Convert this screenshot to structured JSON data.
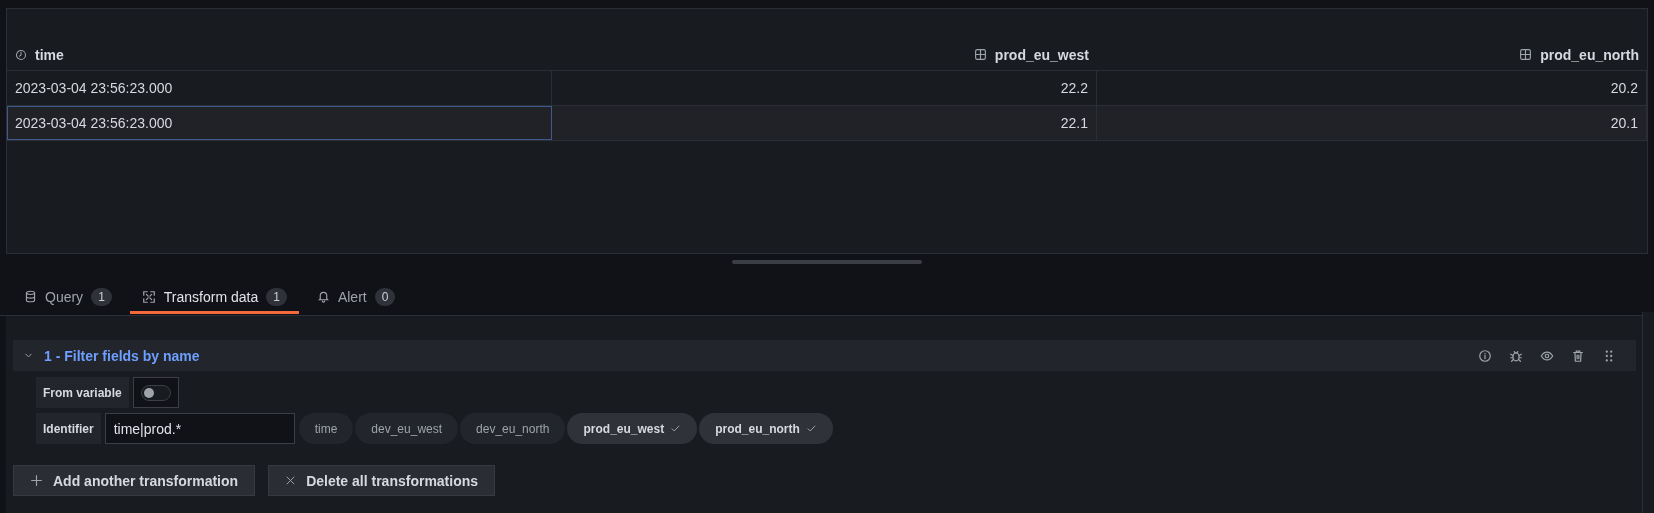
{
  "table": {
    "columns": [
      {
        "label": "time",
        "kind": "time"
      },
      {
        "label": "prod_eu_west",
        "kind": "number"
      },
      {
        "label": "prod_eu_north",
        "kind": "number"
      }
    ],
    "rows": [
      {
        "selected": false,
        "cells": [
          "2023-03-04 23:56:23.000",
          "22.2",
          "20.2"
        ]
      },
      {
        "selected": true,
        "cells": [
          "2023-03-04 23:56:23.000",
          "22.1",
          "20.1"
        ]
      }
    ]
  },
  "tabs": [
    {
      "label": "Query",
      "count": "1",
      "kind": "query",
      "selected": false
    },
    {
      "label": "Transform data",
      "count": "1",
      "kind": "transform",
      "selected": true
    },
    {
      "label": "Alert",
      "count": "0",
      "kind": "alert",
      "selected": false
    }
  ],
  "transformation": {
    "title": "1 - Filter fields by name",
    "expanded": true,
    "from_variable": {
      "label": "From variable",
      "on": false
    },
    "identifier": {
      "label": "Identifier",
      "value": "time|prod.*"
    },
    "fields": [
      {
        "label": "time",
        "selected": false
      },
      {
        "label": "dev_eu_west",
        "selected": false
      },
      {
        "label": "dev_eu_north",
        "selected": false
      },
      {
        "label": "prod_eu_west",
        "selected": true
      },
      {
        "label": "prod_eu_north",
        "selected": true
      }
    ]
  },
  "buttons": [
    {
      "label": "Add another transformation",
      "kind": "add"
    },
    {
      "label": "Delete all transformations",
      "kind": "delete"
    }
  ]
}
